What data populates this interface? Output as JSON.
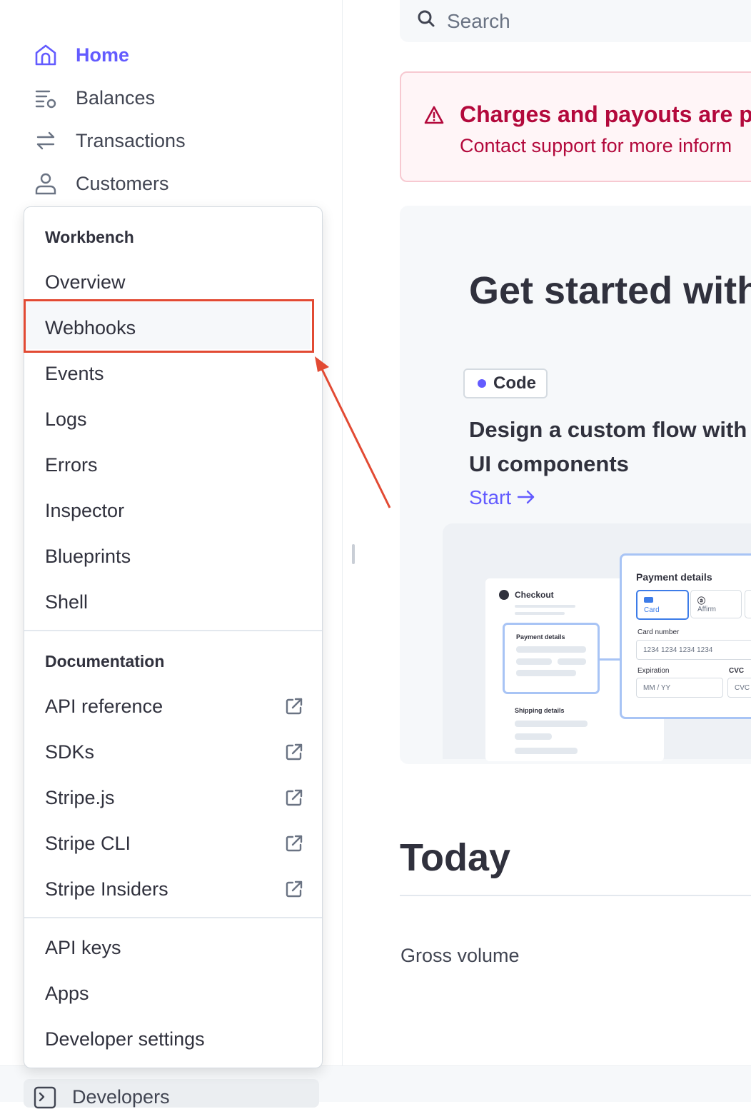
{
  "search": {
    "placeholder": "Search"
  },
  "nav": {
    "items": [
      {
        "label": "Home",
        "icon": "home-icon",
        "active": true
      },
      {
        "label": "Balances",
        "icon": "balances-icon"
      },
      {
        "label": "Transactions",
        "icon": "transactions-icon"
      },
      {
        "label": "Customers",
        "icon": "customers-icon"
      }
    ],
    "developers_label": "Developers"
  },
  "menu": {
    "workbench_heading": "Workbench",
    "workbench_items": [
      "Overview",
      "Webhooks",
      "Events",
      "Logs",
      "Errors",
      "Inspector",
      "Blueprints",
      "Shell"
    ],
    "documentation_heading": "Documentation",
    "documentation_items": [
      "API reference",
      "SDKs",
      "Stripe.js",
      "Stripe CLI",
      "Stripe Insiders"
    ],
    "other_items": [
      "API keys",
      "Apps",
      "Developer settings"
    ],
    "highlighted": "Webhooks"
  },
  "alert": {
    "title": "Charges and payouts are p",
    "subtitle": "Contact support for more inform"
  },
  "getting_started": {
    "title": "Get started with",
    "tag": "Code",
    "heading_line1": "Design a custom flow with",
    "heading_line2": "UI components",
    "cta": "Start",
    "illustration": {
      "checkout_title": "Checkout",
      "mini_payment_label": "Payment details",
      "shipping_label": "Shipping details",
      "payment_title": "Payment details",
      "option_card": "Card",
      "option_affirm": "Affirm",
      "card_number_label": "Card number",
      "card_number_placeholder": "1234 1234 1234 1234",
      "expiration_label": "Expiration",
      "expiration_placeholder": "MM / YY",
      "cvc_label": "CVC",
      "cvc_placeholder": "CVC"
    }
  },
  "today": {
    "title": "Today",
    "gross_volume_label": "Gross volume"
  },
  "colors": {
    "accent": "#635bff",
    "alert": "#b3093c",
    "highlight": "#e24a33"
  }
}
